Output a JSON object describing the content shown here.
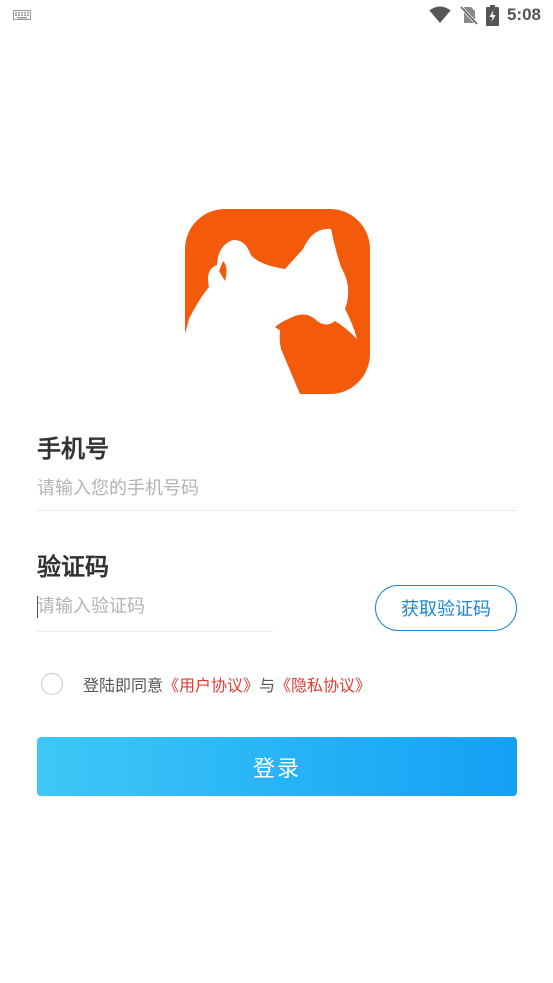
{
  "status_bar": {
    "time": "5:08",
    "icons": [
      "keyboard-icon",
      "wifi-icon",
      "no-sim-icon",
      "battery-charging-icon"
    ]
  },
  "logo": {
    "icon": "app-logo-icon",
    "color": "#f35a0c"
  },
  "form": {
    "phone_label": "手机号",
    "phone_placeholder": "请输入您的手机号码",
    "phone_value": "",
    "code_label": "验证码",
    "code_placeholder": "请输入验证码",
    "code_value": "",
    "get_code_label": "获取验证码"
  },
  "agreement": {
    "checked": false,
    "prefix": "登陆即同意",
    "user_agreement": "《用户协议》",
    "joiner": "与",
    "privacy_agreement": "《隐私协议》"
  },
  "login_label": "登录",
  "colors": {
    "accent_blue": "#1e86d6",
    "link_red": "#e53935",
    "button_gradient_start": "#3dc8f7",
    "button_gradient_end": "#14a0f5",
    "logo_orange": "#f35a0c"
  }
}
